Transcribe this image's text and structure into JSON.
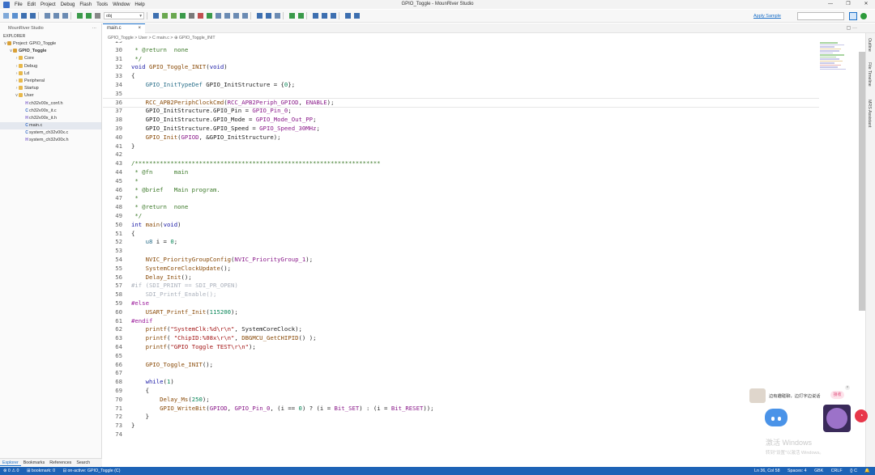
{
  "window": {
    "title": "GPIO_Toggle - MounRiver Studio",
    "menu": [
      "File",
      "Edit",
      "Project",
      "Debug",
      "Flash",
      "Tools",
      "Window",
      "Help"
    ],
    "controls": [
      "—",
      "❐",
      "✕"
    ]
  },
  "toolbar": {
    "build_target": "obj",
    "apply_sample": "Apply Sample"
  },
  "explorer": {
    "panel_title": "MounRiver Studio",
    "more": "···",
    "section": "EXPLORER",
    "tree": [
      {
        "indent": 0,
        "twisty": "∨",
        "icon": "project",
        "label": "Project: GPIO_Toggle",
        "bold": false
      },
      {
        "indent": 1,
        "twisty": "∨",
        "icon": "proj",
        "label": "GPIO_Toggle",
        "bold": true
      },
      {
        "indent": 2,
        "twisty": "›",
        "icon": "folder",
        "label": "Core",
        "bold": false
      },
      {
        "indent": 2,
        "twisty": "›",
        "icon": "folder",
        "label": "Debug",
        "bold": false
      },
      {
        "indent": 2,
        "twisty": "›",
        "icon": "folder",
        "label": "Ld",
        "bold": false
      },
      {
        "indent": 2,
        "twisty": "›",
        "icon": "folder",
        "label": "Peripheral",
        "bold": false
      },
      {
        "indent": 2,
        "twisty": "›",
        "icon": "folder",
        "label": "Startup",
        "bold": false
      },
      {
        "indent": 2,
        "twisty": "∨",
        "icon": "folder",
        "label": "User",
        "bold": false
      },
      {
        "indent": 3,
        "twisty": "",
        "icon": "H",
        "label": "ch32v00x_conf.h",
        "bold": false
      },
      {
        "indent": 3,
        "twisty": "",
        "icon": "C",
        "label": "ch32v00x_it.c",
        "bold": false
      },
      {
        "indent": 3,
        "twisty": "",
        "icon": "H",
        "label": "ch32v00x_it.h",
        "bold": false
      },
      {
        "indent": 3,
        "twisty": "",
        "icon": "C",
        "label": "main.c",
        "bold": false,
        "selected": true
      },
      {
        "indent": 3,
        "twisty": "",
        "icon": "C",
        "label": "system_ch32v00x.c",
        "bold": false
      },
      {
        "indent": 3,
        "twisty": "",
        "icon": "H",
        "label": "system_ch32v00x.h",
        "bold": false
      }
    ],
    "bottom_tabs": [
      "Explorer",
      "Bookmarks",
      "References",
      "Search"
    ]
  },
  "editor": {
    "tab": "main.c",
    "tab_close": "×",
    "breadcrumb": "GPIO_Toggle > User > C main.c > ⊕ GPIO_Toggle_INIT",
    "lines": [
      {
        "n": "29",
        "html": ""
      },
      {
        "n": "30",
        "html": "<span class='cm'> * @return  none</span>"
      },
      {
        "n": "31",
        "html": "<span class='cm'> */</span>"
      },
      {
        "n": "32",
        "html": "<span class='kw'>void</span> <span class='fn'>GPIO_Toggle_INIT</span>(<span class='kw'>void</span>)"
      },
      {
        "n": "33",
        "html": "{"
      },
      {
        "n": "34",
        "html": "    <span class='ty'>GPIO_InitTypeDef</span> GPIO_InitStructure = {<span class='num'>0</span>};"
      },
      {
        "n": "35",
        "html": ""
      },
      {
        "n": "36",
        "html": "    <span class='fn'>RCC_APB2PeriphClockCmd</span>(<span class='mac'>RCC_APB2Periph_GPIOD</span>, <span class='mac'>ENABLE</span>);",
        "cur": true
      },
      {
        "n": "37",
        "html": "    GPIO_InitStructure.GPIO_Pin = <span class='mac'>GPIO_Pin_0</span>;"
      },
      {
        "n": "38",
        "html": "    GPIO_InitStructure.GPIO_Mode = <span class='mac'>GPIO_Mode_Out_PP</span>;"
      },
      {
        "n": "39",
        "html": "    GPIO_InitStructure.GPIO_Speed = <span class='mac'>GPIO_Speed_30MHz</span>;"
      },
      {
        "n": "40",
        "html": "    <span class='fn'>GPIO_Init</span>(<span class='mac'>GPIOD</span>, &amp;GPIO_InitStructure);"
      },
      {
        "n": "41",
        "html": "}"
      },
      {
        "n": "42",
        "html": ""
      },
      {
        "n": "43",
        "html": "<span class='cm'>/*********************************************************************</span>"
      },
      {
        "n": "44",
        "html": "<span class='cm'> * @fn      main</span>"
      },
      {
        "n": "45",
        "html": "<span class='cm'> *</span>"
      },
      {
        "n": "46",
        "html": "<span class='cm'> * @brief   Main program.</span>"
      },
      {
        "n": "47",
        "html": "<span class='cm'> *</span>"
      },
      {
        "n": "48",
        "html": "<span class='cm'> * @return  none</span>"
      },
      {
        "n": "49",
        "html": "<span class='cm'> */</span>"
      },
      {
        "n": "50",
        "html": "<span class='kw'>int</span> <span class='fn'>main</span>(<span class='kw'>void</span>)"
      },
      {
        "n": "51",
        "html": "{"
      },
      {
        "n": "52",
        "html": "    <span class='ty'>u8</span> i = <span class='num'>0</span>;"
      },
      {
        "n": "53",
        "html": ""
      },
      {
        "n": "54",
        "html": "    <span class='fn'>NVIC_PriorityGroupConfig</span>(<span class='mac'>NVIC_PriorityGroup_1</span>);"
      },
      {
        "n": "55",
        "html": "    <span class='fn'>SystemCoreClockUpdate</span>();"
      },
      {
        "n": "56",
        "html": "    <span class='fn'>Delay_Init</span>();"
      },
      {
        "n": "57",
        "html": "<span class='dim'>#if (SDI_PRINT == SDI_PR_OPEN)</span>"
      },
      {
        "n": "58",
        "html": "<span class='dim'>    SDI_Printf_Enable();</span>"
      },
      {
        "n": "59",
        "html": "<span class='pp'>#else</span>"
      },
      {
        "n": "60",
        "html": "    <span class='fn'>USART_Printf_Init</span>(<span class='num'>115200</span>);"
      },
      {
        "n": "61",
        "html": "<span class='pp'>#endif</span>"
      },
      {
        "n": "62",
        "html": "    <span class='fn'>printf</span>(<span class='str'>\"SystemClk:%d\\r\\n\"</span>, SystemCoreClock);"
      },
      {
        "n": "63",
        "html": "    <span class='fn'>printf</span>( <span class='str'>\"ChipID:%08x\\r\\n\"</span>, <span class='fn'>DBGMCU_GetCHIPID</span>() );"
      },
      {
        "n": "64",
        "html": "    <span class='fn'>printf</span>(<span class='str'>\"GPIO Toggle TEST\\r\\n\"</span>);"
      },
      {
        "n": "65",
        "html": ""
      },
      {
        "n": "66",
        "html": "    <span class='fn'>GPIO_Toggle_INIT</span>();"
      },
      {
        "n": "67",
        "html": ""
      },
      {
        "n": "68",
        "html": "    <span class='kw'>while</span>(<span class='num'>1</span>)"
      },
      {
        "n": "69",
        "html": "    {"
      },
      {
        "n": "70",
        "html": "        <span class='fn'>Delay_Ms</span>(<span class='num'>250</span>);"
      },
      {
        "n": "71",
        "html": "        <span class='fn'>GPIO_WriteBit</span>(<span class='mac'>GPIOD</span>, <span class='mac'>GPIO_Pin_0</span>, (i == <span class='num'>0</span>) ? (i = <span class='mac'>Bit_SET</span>) : (i = <span class='mac'>Bit_RESET</span>));"
      },
      {
        "n": "72",
        "html": "    }"
      },
      {
        "n": "73",
        "html": "}"
      },
      {
        "n": "74",
        "html": ""
      }
    ]
  },
  "right_bar": {
    "tabs": [
      "Outline",
      "File Timeline",
      "MRS Assistant"
    ]
  },
  "assistant": {
    "bubble_text": "边有趣碰聊，边打字边说话",
    "pill": "接收",
    "close": "×"
  },
  "watermark": {
    "line1": "激活 Windows",
    "line2": "转到\"设置\"以激活 Windows。"
  },
  "status": {
    "left": [
      "⊗ 0 ⚠ 0",
      "⊞ bookmark: 0",
      "⊟ on-active: GPIO_Toggle (C)"
    ],
    "right": [
      "Ln 36, Col 58",
      "Spaces: 4",
      "GBK",
      "CRLF",
      "{} C",
      "🔔"
    ]
  },
  "colors": {
    "status_bar": "#1d63b6",
    "accent": "#1a6fc8"
  }
}
